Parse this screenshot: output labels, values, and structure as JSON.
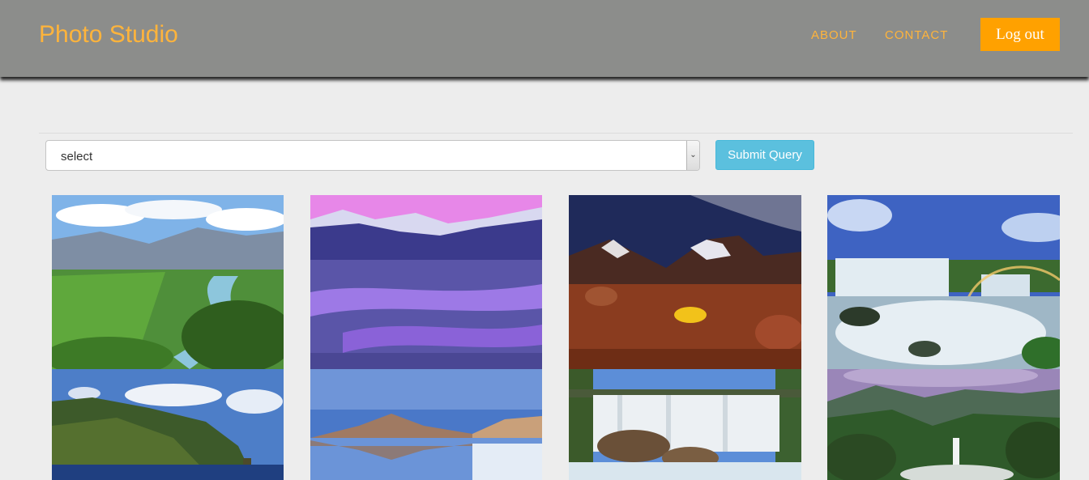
{
  "header": {
    "brand": "Photo Studio",
    "nav": [
      "ABOUT",
      "CONTACT"
    ],
    "logout_label": "Log out"
  },
  "filter": {
    "select_value": "select",
    "submit_label": "Submit Query"
  },
  "gallery": [
    {
      "name": "photo-river-valley"
    },
    {
      "name": "photo-purple-river-mountains"
    },
    {
      "name": "photo-night-camp-mountains"
    },
    {
      "name": "photo-waterfall-rainbow"
    },
    {
      "name": "photo-coastal-cliff"
    },
    {
      "name": "photo-salt-lake-reflection"
    },
    {
      "name": "photo-wide-waterfall"
    },
    {
      "name": "photo-jungle-waterfall"
    }
  ],
  "colors": {
    "navbar": "#8c8d8b",
    "brand": "#ffb43b",
    "logout": "#ffa100",
    "submit": "#5bc0de",
    "background": "#ededed"
  }
}
